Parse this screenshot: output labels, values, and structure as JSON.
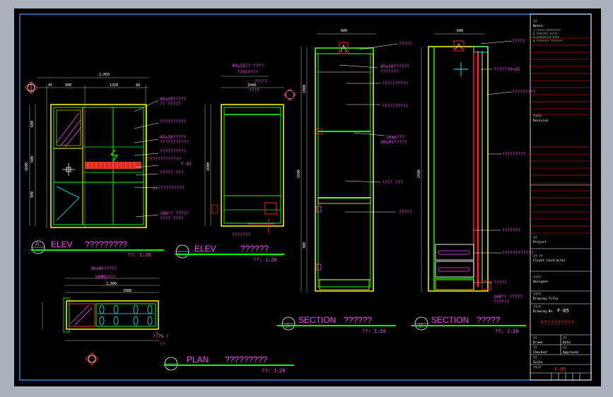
{
  "colors": {
    "background": "#000000",
    "frame": "#3a7ad8",
    "line_green": "#00ff00",
    "line_yellow": "#ffff00",
    "line_red": "#ff2020",
    "text_magenta": "#ff40ff",
    "text_white": "#ffffff",
    "text_cyan": "#00ffff",
    "text_red": "#ff3030"
  },
  "icons": {
    "view_marker": "circle-marker-icon",
    "section_marker": "section-cut-icon",
    "crosshair": "crosshair-cursor-icon"
  },
  "elev_a": {
    "marker": "A",
    "title": "ELEV",
    "subtitle": "?????????",
    "scale": "??: 1:20",
    "dims_top": [
      "2,850",
      "45",
      "900",
      "1320",
      "60"
    ],
    "dims_left": [
      "600",
      "600",
      "900",
      "600",
      "2600"
    ],
    "notes": [
      "45x20?????",
      "?? ?????",
      "??????????",
      "45x20?????",
      "???????????",
      "??????????",
      "?????????????",
      "F-02",
      "????? ???",
      "1:??????????",
      "100?? ?????",
      "???? ????"
    ]
  },
  "elev_b": {
    "title": "ELEV",
    "subtitle": "??????",
    "scale": "??: 1:20",
    "notes": [
      "45x15?? ????",
      "??55????",
      "?????",
      "????",
      "1040",
      "2600",
      "???????"
    ]
  },
  "section_b": {
    "marker": "B",
    "title": "SECTION",
    "subtitle": "??????",
    "scale": "??: 1:10",
    "dims": [
      "600",
      "1000",
      "2600",
      "300"
    ],
    "notes": [
      "?????",
      "45x20??????",
      "???????",
      "??????????",
      "??????????",
      "10mm???",
      "30x45?????",
      "???? ???",
      "?????"
    ]
  },
  "section_c": {
    "marker": "C",
    "title": "SECTION",
    "subtitle": "?????",
    "scale": "??: 1:10",
    "dims": [
      "600",
      "2600"
    ],
    "notes": [
      "?????",
      "??????D=25",
      "?????????",
      "?????????",
      "???????",
      "????????????",
      "?????",
      "100?? ?????",
      "??????"
    ]
  },
  "plan": {
    "title": "PLAN",
    "subtitle": "?????????",
    "scale": "??: 1:20",
    "notes": [
      "30x45?????",
      "10MM????",
      "1,800",
      "1000",
      "???? ?",
      "??"
    ]
  },
  "title_block": {
    "label_notes": "??",
    "heading_notes": "Notes:",
    "note_lines": [
      "1.????? ?????????",
      "2.??????? ?????",
      "3.????????? ????",
      "4.???????? ???????"
    ],
    "label_revision": "????",
    "heading_revision": "Revision",
    "label_project": "??",
    "heading_project": "Project",
    "label_contractor": "?? ??",
    "heading_contractor": "Client Contractor",
    "label_design": "????",
    "heading_design": "Designer",
    "label_drawing_title": "????",
    "heading_drawing_title": "Drawing Title",
    "drawing_no": "F-05",
    "drawing_title": "??????????",
    "label_drawn": "??",
    "heading_drawn": "Drawn",
    "label_date": "??",
    "heading_date": "Date",
    "label_checked": "??",
    "heading_checked": "Checked",
    "label_approved": "??",
    "heading_approved": "Approved",
    "label_scale": "??",
    "heading_scale": "Scale",
    "label_drawing_no": "????",
    "heading_drawing_no": "Drawing No.",
    "drawing_no_bottom": "F-05"
  }
}
